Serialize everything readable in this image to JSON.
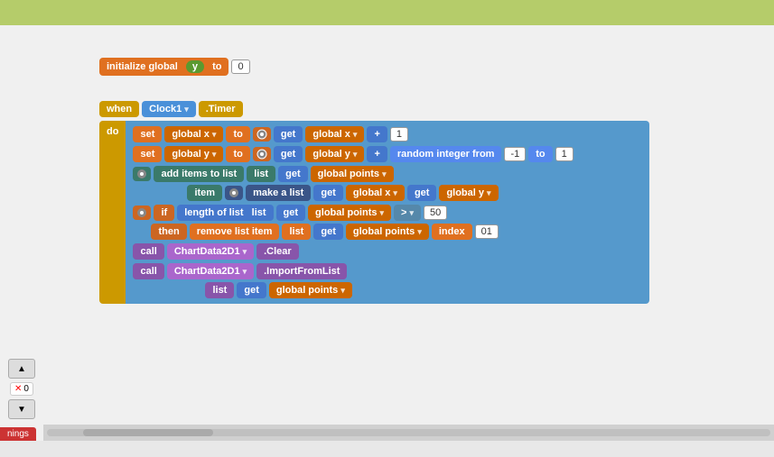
{
  "topBar": {
    "color": "#b5cc6a"
  },
  "blocks": {
    "initBlock": {
      "label": "initialize global",
      "varName": "y",
      "toLabel": "to",
      "value": "0"
    },
    "whenBlock": {
      "label": "when",
      "clock": "Clock1",
      "timerLabel": ".Timer"
    },
    "doLabel": "do",
    "setX": {
      "setLabel": "set",
      "varName": "global x",
      "toLabel": "to",
      "getLabel": "get",
      "getVar": "global x",
      "plusLabel": "+",
      "value": "1"
    },
    "setY": {
      "setLabel": "set",
      "varName": "global y",
      "toLabel": "to",
      "getLabel": "get",
      "getVar": "global y",
      "plusLabel": "+",
      "randomLabel": "random integer from",
      "fromVal": "-1",
      "toLabel2": "to",
      "toVal": "1"
    },
    "addItems": {
      "addLabel": "add items to list",
      "listLabel": "list",
      "getLabel": "get",
      "listVar": "global points",
      "itemLabel": "item",
      "makeListLabel": "make a list",
      "getX": "get",
      "xVar": "global x",
      "getY": "get",
      "yVar": "global y"
    },
    "ifBlock": {
      "ifLabel": "if",
      "lengthLabel": "length of list",
      "listLabel": "list",
      "getLabel": "get",
      "listVar": "global points",
      "gtLabel": ">",
      "value": "50",
      "thenLabel": "then",
      "removeLabel": "remove list item",
      "removeLList": "list",
      "removeGet": "get",
      "removeVar": "global points",
      "indexLabel": "index",
      "indexVal": "01"
    },
    "callClear": {
      "callLabel": "call",
      "component": "ChartData2D1",
      "method": ".Clear"
    },
    "callImport": {
      "callLabel": "call",
      "component": "ChartData2D1",
      "method": ".ImportFromList",
      "listLabel": "list",
      "getLabel": "get",
      "listVar": "global points"
    }
  },
  "leftPanel": {
    "upArrow": "▲",
    "warningCount": "0",
    "downArrow": "▼",
    "warningsLabel": "nings"
  }
}
